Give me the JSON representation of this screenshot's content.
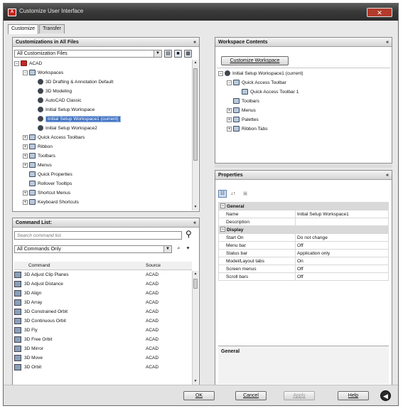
{
  "window": {
    "title": "Customize User Interface",
    "close_glyph": "✕"
  },
  "tabs": [
    {
      "label": "Customize"
    },
    {
      "label": "Transfer"
    }
  ],
  "customizations": {
    "header": "Customizations in All Files",
    "pin": "«",
    "file_combo": "All Customization Files",
    "tree": [
      {
        "label": "ACAD",
        "level": 0,
        "exp": "−",
        "icon": "red"
      },
      {
        "label": "Workspaces",
        "level": 1,
        "exp": "−",
        "icon": "fold"
      },
      {
        "label": "3D Drafting & Annotation Default",
        "level": 2,
        "icon": "gear"
      },
      {
        "label": "3D Modeling",
        "level": 2,
        "icon": "gear"
      },
      {
        "label": "AutoCAD Classic",
        "level": 2,
        "icon": "gear"
      },
      {
        "label": "Initial Setup Workspace",
        "level": 2,
        "icon": "gear"
      },
      {
        "label": "Initial Setup Workspace1 (current)",
        "level": 2,
        "icon": "gear",
        "selected": true
      },
      {
        "label": "Initial Setup Workspace2",
        "level": 2,
        "icon": "gear"
      },
      {
        "label": "Quick Access Toolbars",
        "level": 1,
        "exp": "+",
        "icon": "fold"
      },
      {
        "label": "Ribbon",
        "level": 1,
        "exp": "+",
        "icon": "fold"
      },
      {
        "label": "Toolbars",
        "level": 1,
        "exp": "+",
        "icon": "fold"
      },
      {
        "label": "Menus",
        "level": 1,
        "exp": "+",
        "icon": "fold"
      },
      {
        "label": "Quick Properties",
        "level": 1,
        "icon": "fold"
      },
      {
        "label": "Rollover Tooltips",
        "level": 1,
        "icon": "fold"
      },
      {
        "label": "Shortcut Menus",
        "level": 1,
        "exp": "+",
        "icon": "fold"
      },
      {
        "label": "Keyboard Shortcuts",
        "level": 1,
        "exp": "+",
        "icon": "fold"
      }
    ]
  },
  "command_list": {
    "header": "Command List:",
    "pin": "«",
    "search_placeholder": "Search command list",
    "filter_combo": "All Commands Only",
    "col_command": "Command",
    "col_source": "Source",
    "rows": [
      {
        "command": "3D Adjust Clip Planes",
        "source": "ACAD"
      },
      {
        "command": "3D Adjust Distance",
        "source": "ACAD"
      },
      {
        "command": "3D Align",
        "source": "ACAD"
      },
      {
        "command": "3D Array",
        "source": "ACAD"
      },
      {
        "command": "3D Constrained Orbit",
        "source": "ACAD"
      },
      {
        "command": "3D Continuous Orbit",
        "source": "ACAD"
      },
      {
        "command": "3D Fly",
        "source": "ACAD"
      },
      {
        "command": "3D Free Orbit",
        "source": "ACAD"
      },
      {
        "command": "3D Mirror",
        "source": "ACAD"
      },
      {
        "command": "3D Move",
        "source": "ACAD"
      },
      {
        "command": "3D Orbit",
        "source": "ACAD"
      }
    ]
  },
  "workspace_contents": {
    "header": "Workspace Contents",
    "pin": "«",
    "customize_button": "Customize Workspace",
    "tree": [
      {
        "label": "Initial Setup Workspace1 (current)",
        "level": 0,
        "exp": "−",
        "icon": "gear"
      },
      {
        "label": "Quick Access Toolbar",
        "level": 1,
        "exp": "−",
        "icon": "fold"
      },
      {
        "label": "Quick Access Toolbar 1",
        "level": 2,
        "icon": "fold"
      },
      {
        "label": "Toolbars",
        "level": 1,
        "icon": "fold"
      },
      {
        "label": "Menus",
        "level": 1,
        "exp": "+",
        "icon": "fold"
      },
      {
        "label": "Palettes",
        "level": 1,
        "exp": "+",
        "icon": "fold"
      },
      {
        "label": "Ribbon Tabs",
        "level": 1,
        "exp": "+",
        "icon": "fold"
      }
    ]
  },
  "properties": {
    "header": "Properties",
    "pin": "«",
    "sections": [
      {
        "name": "General",
        "rows": [
          {
            "key": "Name",
            "value": "Initial Setup Workspace1"
          },
          {
            "key": "Description",
            "value": ""
          }
        ]
      },
      {
        "name": "Display",
        "rows": [
          {
            "key": "Start On",
            "value": "Do not change"
          },
          {
            "key": "Menu bar",
            "value": "Off"
          },
          {
            "key": "Status bar",
            "value": "Application only"
          },
          {
            "key": "Model/Layout tabs",
            "value": "On"
          },
          {
            "key": "Screen menus",
            "value": "Off"
          },
          {
            "key": "Scroll bars",
            "value": "Off"
          }
        ]
      }
    ],
    "description_title": "General"
  },
  "footer": {
    "ok": "OK",
    "cancel": "Cancel",
    "apply": "Apply",
    "help": "Help",
    "expand_glyph": "◀"
  }
}
